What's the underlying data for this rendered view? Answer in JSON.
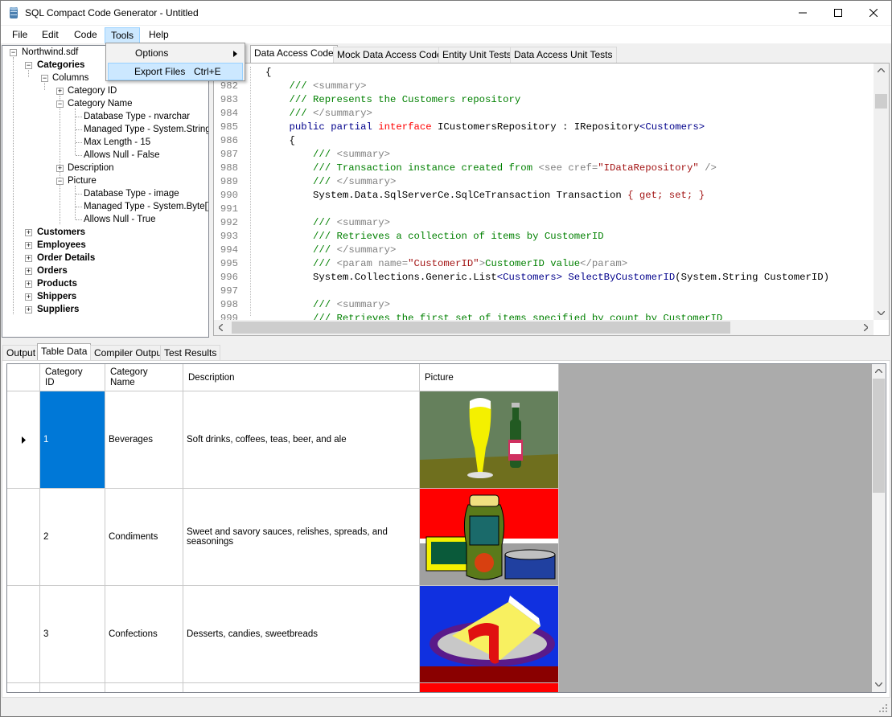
{
  "window": {
    "title": "SQL Compact Code Generator - Untitled"
  },
  "menu": {
    "file": "File",
    "edit": "Edit",
    "code": "Code",
    "tools": "Tools",
    "help": "Help"
  },
  "tools_menu": {
    "options": "Options",
    "export_files": "Export Files",
    "export_shortcut": "Ctrl+E"
  },
  "tree": {
    "root": "Northwind.sdf",
    "categories": "Categories",
    "columns": "Columns",
    "category_id": "Category ID",
    "category_name": "Category Name",
    "cn_props": [
      "Database Type - nvarchar",
      "Managed Type - System.String",
      "Max Length - 15",
      "Allows Null - False"
    ],
    "description": "Description",
    "picture": "Picture",
    "pic_props": [
      "Database Type - image",
      "Managed Type - System.Byte[]",
      "Allows Null - True"
    ],
    "tables": [
      "Customers",
      "Employees",
      "Order Details",
      "Orders",
      "Products",
      "Shippers",
      "Suppliers"
    ]
  },
  "code_tabs": [
    "Data Access Code",
    "Mock Data Access Code",
    "Entity Unit Tests",
    "Data Access Unit Tests"
  ],
  "code": {
    "line_numbers": [
      "",
      "982",
      "983",
      "984",
      "985",
      "986",
      "987",
      "988",
      "989",
      "990",
      "991",
      "992",
      "993",
      "994",
      "995",
      "996",
      "997",
      "998",
      "999"
    ],
    "lines": [
      [
        [
          "{",
          ""
        ]
      ],
      [
        [
          "    /// ",
          "c-g"
        ],
        [
          "<summary>",
          "c-gr"
        ]
      ],
      [
        [
          "    /// Represents the Customers repository",
          "c-g"
        ]
      ],
      [
        [
          "    /// ",
          "c-g"
        ],
        [
          "</summary>",
          "c-gr"
        ]
      ],
      [
        [
          "    ",
          ""
        ],
        [
          "public",
          "c-n"
        ],
        [
          " ",
          ""
        ],
        [
          "partial",
          "c-n"
        ],
        [
          " ",
          ""
        ],
        [
          "interface",
          "c-r"
        ],
        [
          " ICustomersRepository : IRepository",
          ""
        ],
        [
          "<Customers>",
          "c-n"
        ]
      ],
      [
        [
          "    {",
          ""
        ]
      ],
      [
        [
          "        /// ",
          "c-g"
        ],
        [
          "<summary>",
          "c-gr"
        ]
      ],
      [
        [
          "        /// Transaction instance created from ",
          "c-g"
        ],
        [
          "<see cref=",
          "c-gr"
        ],
        [
          "\"IDataRepository\"",
          "c-o"
        ],
        [
          " />",
          "c-gr"
        ]
      ],
      [
        [
          "        /// ",
          "c-g"
        ],
        [
          "</summary>",
          "c-gr"
        ]
      ],
      [
        [
          "        System.Data.SqlServerCe.SqlCeTransaction Transaction ",
          ""
        ],
        [
          "{ get; set; }",
          "c-o"
        ]
      ],
      [
        [
          "",
          ""
        ]
      ],
      [
        [
          "        /// ",
          "c-g"
        ],
        [
          "<summary>",
          "c-gr"
        ]
      ],
      [
        [
          "        /// Retrieves a collection of items by CustomerID",
          "c-g"
        ]
      ],
      [
        [
          "        /// ",
          "c-g"
        ],
        [
          "</summary>",
          "c-gr"
        ]
      ],
      [
        [
          "        /// ",
          "c-g"
        ],
        [
          "<param name=",
          "c-gr"
        ],
        [
          "\"CustomerID\"",
          "c-o"
        ],
        [
          ">",
          "c-gr"
        ],
        [
          "CustomerID value",
          "c-g"
        ],
        [
          "</param>",
          "c-gr"
        ]
      ],
      [
        [
          "        System.Collections.Generic.List",
          ""
        ],
        [
          "<Customers>",
          "c-n"
        ],
        [
          " ",
          ""
        ],
        [
          "SelectByCustomerID",
          "c-n"
        ],
        [
          "(System.String CustomerID)",
          ""
        ]
      ],
      [
        [
          "",
          ""
        ]
      ],
      [
        [
          "        /// ",
          "c-g"
        ],
        [
          "<summary>",
          "c-gr"
        ]
      ],
      [
        [
          "        /// Retrieves the first set of items specified by count by CustomerID",
          "c-g"
        ]
      ]
    ]
  },
  "bottom_tabs": [
    "Output",
    "Table Data",
    "Compiler Output",
    "Test Results"
  ],
  "grid": {
    "headers": [
      "Category ID",
      "Category Name",
      "Description",
      "Picture"
    ],
    "rows": [
      {
        "id": "1",
        "name": "Beverages",
        "desc": "Soft drinks, coffees, teas, beer, and ale"
      },
      {
        "id": "2",
        "name": "Condiments",
        "desc": "Sweet and savory sauces, relishes, spreads, and seasonings"
      },
      {
        "id": "3",
        "name": "Confections",
        "desc": "Desserts, candies, sweetbreads"
      }
    ]
  },
  "colors": {
    "selection": "#0078d7",
    "grid_bg": "#ababab"
  }
}
